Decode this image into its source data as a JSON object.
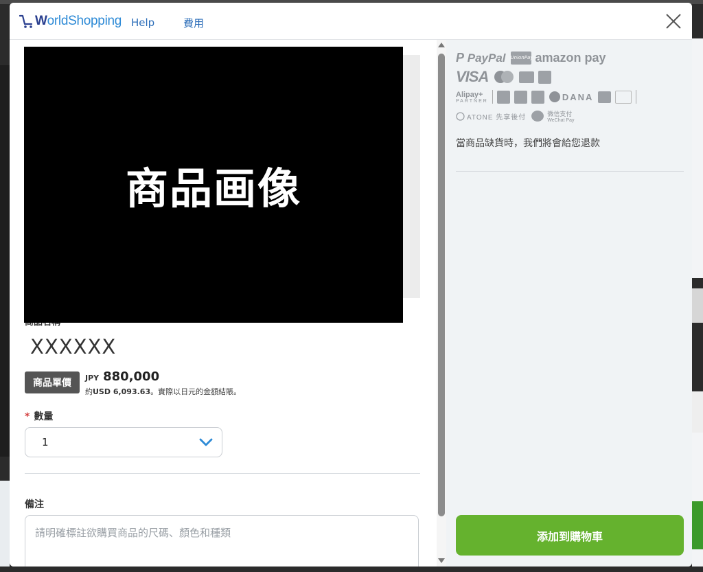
{
  "header": {
    "logo_text_initial": "W",
    "logo_text_rest": "orldShopping",
    "nav": {
      "help": "Help",
      "fees": "費用"
    },
    "close_icon": "close-icon"
  },
  "product": {
    "image_caption": "商品画像",
    "name_label": "商品名稱",
    "name": "XXXXXX",
    "price_badge": "商品單價",
    "currency": "JPY",
    "price": "880,000",
    "approx_prefix": "約",
    "approx_usd": "USD 6,093.63",
    "approx_suffix": "。實際以日元的金額結賬。"
  },
  "quantity": {
    "required_mark": "*",
    "label": "數量",
    "selected": "1",
    "chevron_icon": "chevron-down-icon"
  },
  "remarks": {
    "label": "備注",
    "placeholder": "請明確標註欲購買商品的尺碼、顏色和種類"
  },
  "payment": {
    "logos": {
      "paypal": "PayPal",
      "unionpay": "UnionPay",
      "amazon_pay": "amazon pay",
      "visa": "VISA",
      "alipay": "Alipay+",
      "alipay_partner": "PARTNER",
      "dana": "DANA",
      "atone": "ATONE 先享後付",
      "wechat": "微信支付",
      "wechat_en": "WeChat Pay"
    },
    "refund_notice": "當商品缺貨時，我們將會給您退款"
  },
  "actions": {
    "add_to_cart": "添加到購物車"
  },
  "colors": {
    "brand_blue": "#2d8ad6",
    "accent_green": "#65b22e",
    "required_red": "#d23a3a"
  }
}
